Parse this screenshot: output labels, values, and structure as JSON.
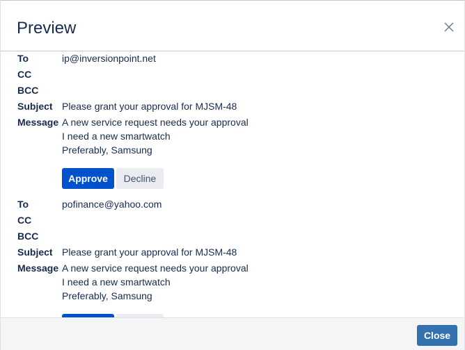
{
  "dialog": {
    "title": "Preview",
    "close_label": "Close"
  },
  "labels": {
    "to": "To",
    "cc": "CC",
    "bcc": "BCC",
    "subject": "Subject",
    "message": "Message"
  },
  "buttons": {
    "approve": "Approve",
    "decline": "Decline"
  },
  "emails": [
    {
      "to": "ip@inversionpoint.net",
      "cc": "",
      "bcc": "",
      "subject": "Please grant your approval for MJSM-48",
      "message_lines": [
        "A new service request needs your approval",
        "I need a new smartwatch",
        "Preferably, Samsung"
      ]
    },
    {
      "to": "pofinance@yahoo.com",
      "cc": "",
      "bcc": "",
      "subject": "Please grant your approval for MJSM-48",
      "message_lines": [
        "A new service request needs your approval",
        "I need a new smartwatch",
        "Preferably, Samsung"
      ]
    }
  ],
  "icons": {
    "close": "close-icon"
  },
  "colors": {
    "approve_bg": "#0052cc",
    "decline_bg": "#ebecf0",
    "close_bg": "#3572b0",
    "footer_bg": "#f4f5f7"
  }
}
